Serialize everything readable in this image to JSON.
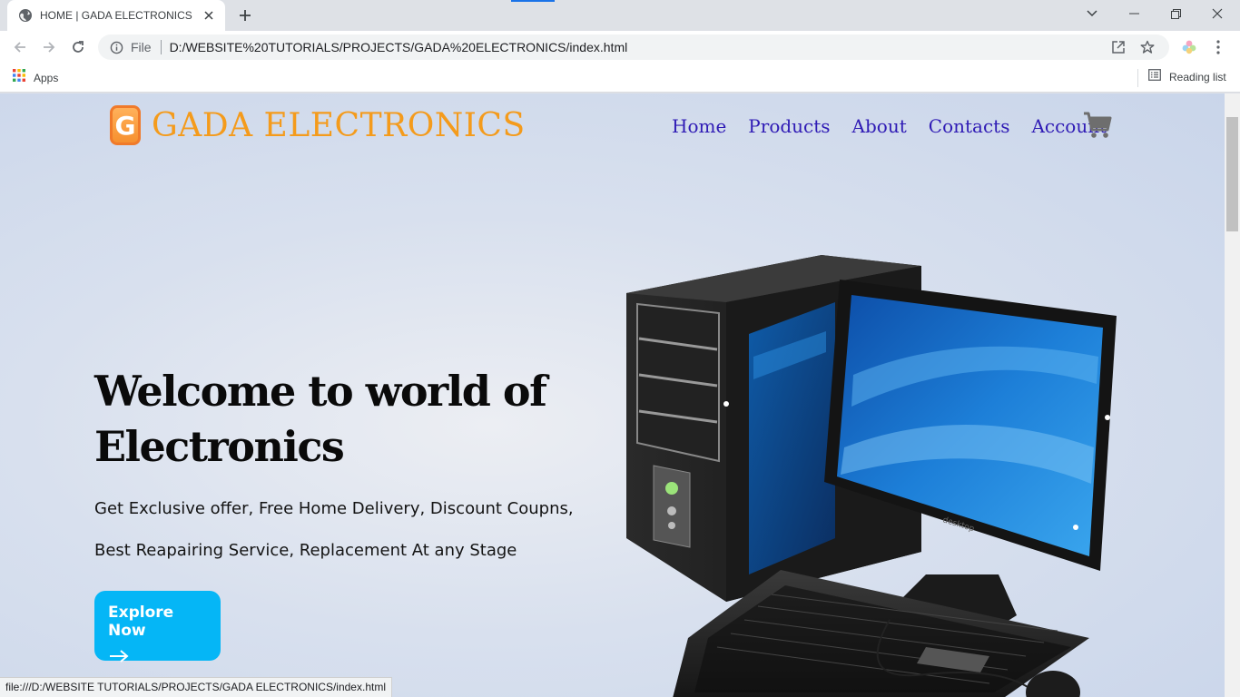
{
  "browser": {
    "tab": {
      "title": "HOME | GADA ELECTRONICS"
    },
    "omnibox": {
      "scheme": "File",
      "url": "D:/WEBSITE%20TUTORIALS/PROJECTS/GADA%20ELECTRONICS/index.html"
    },
    "bookmarks": {
      "apps_label": "Apps",
      "reading_list_label": "Reading list"
    },
    "status_url": "file:///D:/WEBSITE TUTORIALS/PROJECTS/GADA ELECTRONICS/index.html",
    "accent_color": "#1a73e8"
  },
  "site": {
    "logo_letter": "G",
    "brand": "GADA ELECTRONICS",
    "brand_color": "#f49b1c",
    "nav": [
      "Home",
      "Products",
      "About",
      "Contacts",
      "Account"
    ],
    "nav_color": "#2f1bb5",
    "cart_icon": "shopping-cart-icon",
    "hero": {
      "title": "Welcome to world of Electronics",
      "subtitle": "Get Exclusive offer, Free Home Delivery, Discount Coupns, Best Reapairing Service, Replacement At any Stage",
      "cta": "Explore Now",
      "cta_icon": "arrow-right-icon",
      "cta_color": "#05b6f6"
    }
  }
}
